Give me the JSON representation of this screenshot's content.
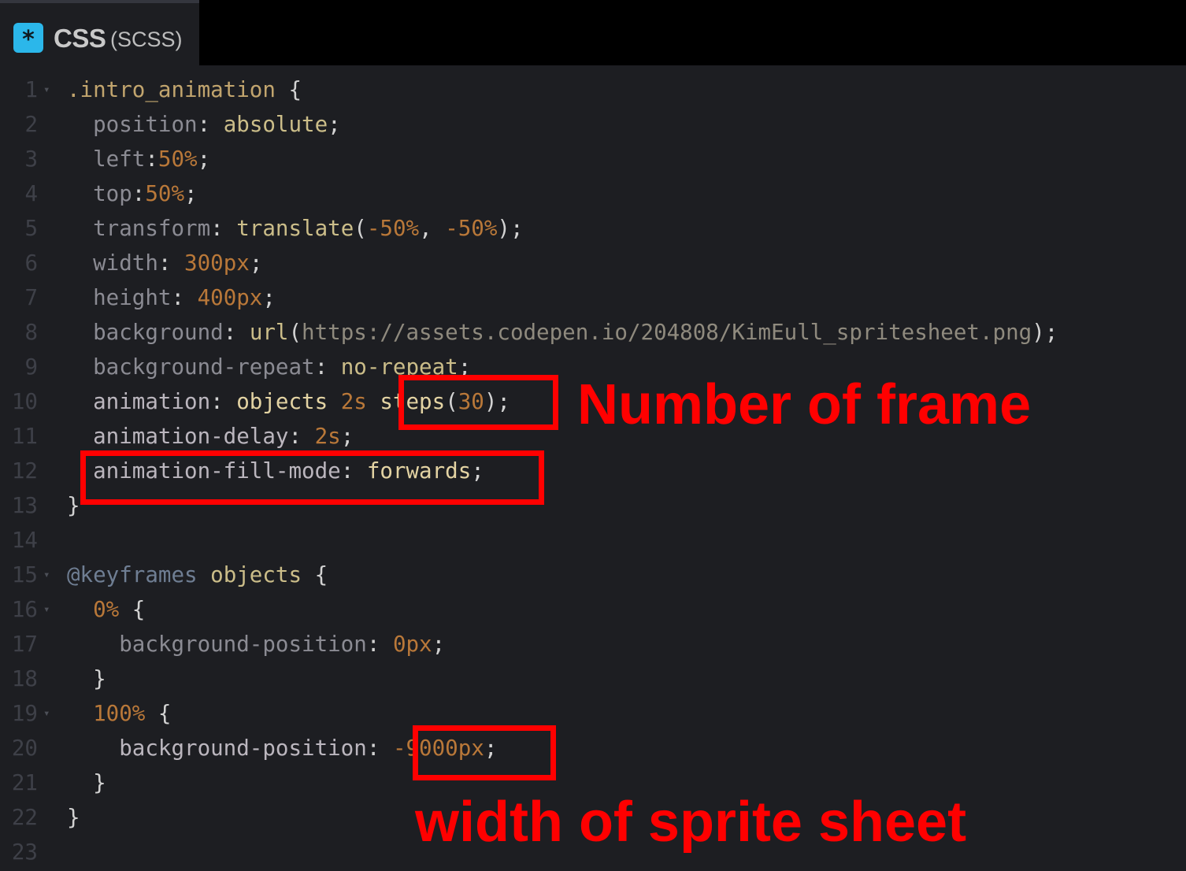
{
  "tab": {
    "icon": "*",
    "language": "CSS",
    "preprocessor": "(SCSS)"
  },
  "lines": [
    {
      "n": "1",
      "fold": true,
      "tokens": [
        {
          "t": ".intro_animation",
          "c": "sel"
        },
        {
          "t": " {",
          "c": "punc"
        }
      ]
    },
    {
      "n": "2",
      "tokens": [
        {
          "t": "  position",
          "c": "prop"
        },
        {
          "t": ": ",
          "c": "punc"
        },
        {
          "t": "absolute",
          "c": "val"
        },
        {
          "t": ";",
          "c": "punc"
        }
      ]
    },
    {
      "n": "3",
      "tokens": [
        {
          "t": "  left",
          "c": "prop"
        },
        {
          "t": ":",
          "c": "punc"
        },
        {
          "t": "50%",
          "c": "num"
        },
        {
          "t": ";",
          "c": "punc"
        }
      ]
    },
    {
      "n": "4",
      "tokens": [
        {
          "t": "  top",
          "c": "prop"
        },
        {
          "t": ":",
          "c": "punc"
        },
        {
          "t": "50%",
          "c": "num"
        },
        {
          "t": ";",
          "c": "punc"
        }
      ]
    },
    {
      "n": "5",
      "tokens": [
        {
          "t": "  transform",
          "c": "prop"
        },
        {
          "t": ": ",
          "c": "punc"
        },
        {
          "t": "translate",
          "c": "val"
        },
        {
          "t": "(",
          "c": "punc"
        },
        {
          "t": "-50%",
          "c": "num"
        },
        {
          "t": ", ",
          "c": "punc"
        },
        {
          "t": "-50%",
          "c": "num"
        },
        {
          "t": ");",
          "c": "punc"
        }
      ]
    },
    {
      "n": "6",
      "tokens": [
        {
          "t": "  width",
          "c": "prop"
        },
        {
          "t": ": ",
          "c": "punc"
        },
        {
          "t": "300px",
          "c": "num"
        },
        {
          "t": ";",
          "c": "punc"
        }
      ]
    },
    {
      "n": "7",
      "tokens": [
        {
          "t": "  height",
          "c": "prop"
        },
        {
          "t": ": ",
          "c": "punc"
        },
        {
          "t": "400px",
          "c": "num"
        },
        {
          "t": ";",
          "c": "punc"
        }
      ]
    },
    {
      "n": "8",
      "tokens": [
        {
          "t": "  background",
          "c": "prop"
        },
        {
          "t": ": ",
          "c": "punc"
        },
        {
          "t": "url",
          "c": "val"
        },
        {
          "t": "(",
          "c": "punc"
        },
        {
          "t": "https://assets.codepen.io/204808/KimEull_spritesheet.png",
          "c": "url"
        },
        {
          "t": ");",
          "c": "punc"
        }
      ]
    },
    {
      "n": "9",
      "tokens": [
        {
          "t": "  background-repeat",
          "c": "prop"
        },
        {
          "t": ": ",
          "c": "punc"
        },
        {
          "t": "no-repeat",
          "c": "val"
        },
        {
          "t": ";",
          "c": "punc"
        }
      ]
    },
    {
      "n": "10",
      "tokens": [
        {
          "t": "  animation",
          "c": "hl-prop"
        },
        {
          "t": ": ",
          "c": "punc"
        },
        {
          "t": "objects ",
          "c": "hl-val"
        },
        {
          "t": "2s",
          "c": "num"
        },
        {
          "t": " ",
          "c": "punc"
        },
        {
          "t": "steps",
          "c": "hl-val"
        },
        {
          "t": "(",
          "c": "punc"
        },
        {
          "t": "30",
          "c": "num"
        },
        {
          "t": ");",
          "c": "punc"
        }
      ]
    },
    {
      "n": "11",
      "tokens": [
        {
          "t": "  animation-delay",
          "c": "hl-prop"
        },
        {
          "t": ": ",
          "c": "punc"
        },
        {
          "t": "2s",
          "c": "num"
        },
        {
          "t": ";",
          "c": "punc"
        }
      ]
    },
    {
      "n": "12",
      "tokens": [
        {
          "t": "  animation-fill-mode",
          "c": "hl-prop"
        },
        {
          "t": ": ",
          "c": "punc"
        },
        {
          "t": "forwards",
          "c": "hl-val"
        },
        {
          "t": ";",
          "c": "punc"
        }
      ]
    },
    {
      "n": "13",
      "tokens": [
        {
          "t": "}",
          "c": "punc"
        }
      ]
    },
    {
      "n": "14",
      "tokens": []
    },
    {
      "n": "15",
      "fold": true,
      "tokens": [
        {
          "t": "@keyframes",
          "c": "at"
        },
        {
          "t": " ",
          "c": "punc"
        },
        {
          "t": "objects",
          "c": "val"
        },
        {
          "t": " {",
          "c": "punc"
        }
      ]
    },
    {
      "n": "16",
      "fold": true,
      "tokens": [
        {
          "t": "  0%",
          "c": "num"
        },
        {
          "t": " {",
          "c": "punc"
        }
      ]
    },
    {
      "n": "17",
      "tokens": [
        {
          "t": "    background-position",
          "c": "prop"
        },
        {
          "t": ": ",
          "c": "punc"
        },
        {
          "t": "0px",
          "c": "num"
        },
        {
          "t": ";",
          "c": "punc"
        }
      ]
    },
    {
      "n": "18",
      "tokens": [
        {
          "t": "  }",
          "c": "punc"
        }
      ]
    },
    {
      "n": "19",
      "fold": true,
      "tokens": [
        {
          "t": "  100%",
          "c": "num"
        },
        {
          "t": " {",
          "c": "punc"
        }
      ]
    },
    {
      "n": "20",
      "tokens": [
        {
          "t": "    background-position",
          "c": "hl-prop"
        },
        {
          "t": ": ",
          "c": "punc"
        },
        {
          "t": "-9000px",
          "c": "num"
        },
        {
          "t": ";",
          "c": "punc"
        }
      ]
    },
    {
      "n": "21",
      "tokens": [
        {
          "t": "  }",
          "c": "punc"
        }
      ]
    },
    {
      "n": "22",
      "tokens": [
        {
          "t": "}",
          "c": "punc"
        }
      ]
    },
    {
      "n": "23",
      "tokens": []
    }
  ],
  "annotations": {
    "frames_label": "Number of frame",
    "width_label": "width of sprite sheet"
  },
  "colors": {
    "annotation": "#ff0000",
    "editor_bg": "#1d1e22",
    "scss_icon": "#2bb7ea"
  }
}
